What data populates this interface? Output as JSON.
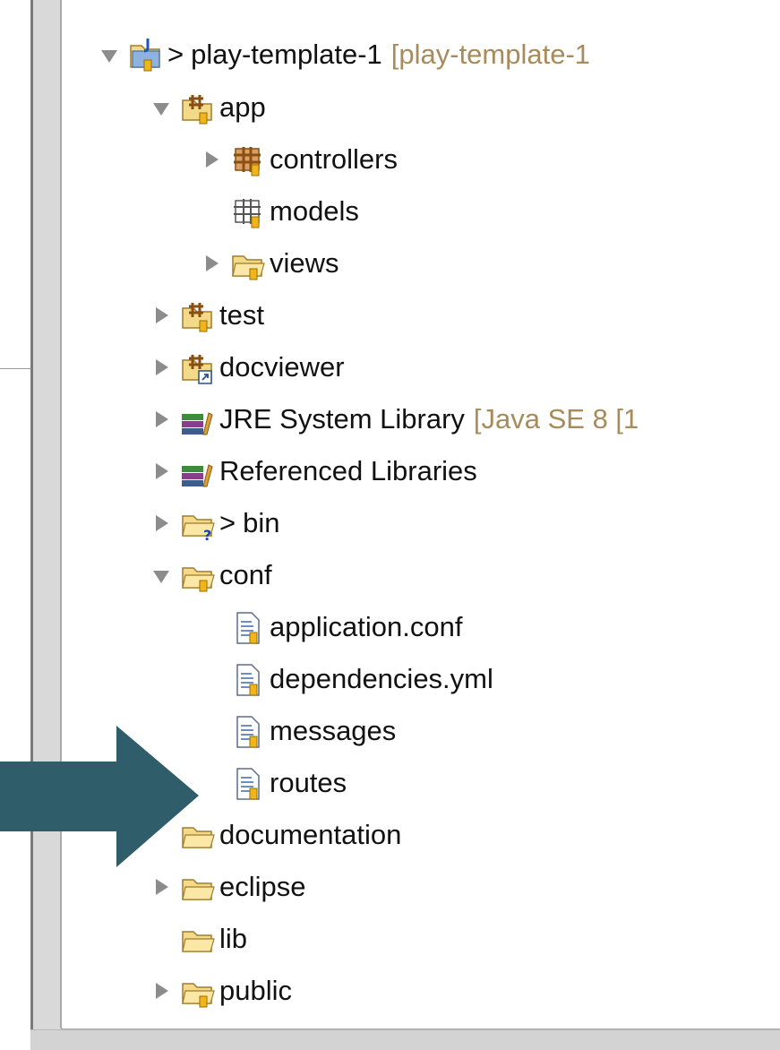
{
  "tree": {
    "project": {
      "prefix": ">",
      "label": "play-template-1",
      "decor": "[play-template-1"
    },
    "app": {
      "label": "app"
    },
    "controllers": {
      "label": "controllers"
    },
    "models": {
      "label": "models"
    },
    "views": {
      "label": "views"
    },
    "test": {
      "label": "test"
    },
    "docviewer": {
      "label": "docviewer"
    },
    "jre": {
      "label": "JRE System Library",
      "decor": "[Java SE 8 [1"
    },
    "reflibs": {
      "label": "Referenced Libraries"
    },
    "bin": {
      "prefix": ">",
      "label": "bin"
    },
    "conf": {
      "label": "conf"
    },
    "application_conf": {
      "label": "application.conf"
    },
    "dependencies": {
      "label": "dependencies.yml"
    },
    "messages": {
      "label": "messages"
    },
    "routes": {
      "label": "routes"
    },
    "documentation": {
      "label": "documentation"
    },
    "eclipse": {
      "label": "eclipse"
    },
    "lib": {
      "label": "lib"
    },
    "public": {
      "label": "public"
    }
  },
  "icons": {
    "project": "java-project-icon",
    "source_folder": "package-folder-icon",
    "package": "package-icon",
    "folder": "folder-icon",
    "library": "library-icon",
    "file": "file-icon"
  },
  "colors": {
    "decoration": "#a88b5b",
    "arrow": "#2f5d6a",
    "twisty": "#8c8c8c"
  }
}
